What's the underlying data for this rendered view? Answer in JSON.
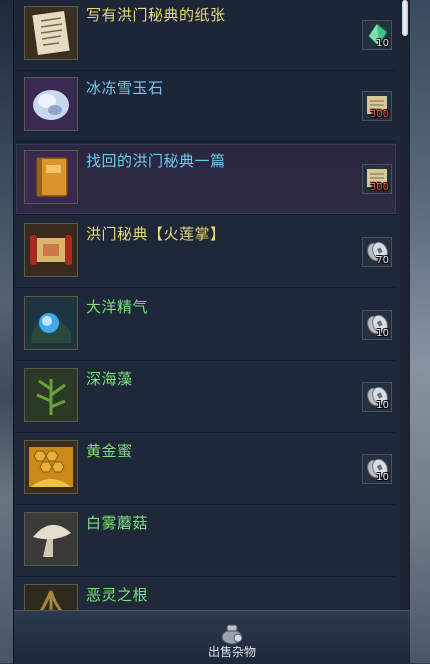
{
  "colors": {
    "name_gold": "#e9d77a",
    "name_blue": "#6fc8ee",
    "name_green": "#7be07b",
    "price_red": "#ff4a3a"
  },
  "items": [
    {
      "name": "写有洪门秘典的纸张",
      "name_color": "#e9d77a",
      "icon": "paper-scroll-icon",
      "currency": "jade-icon",
      "price": "10"
    },
    {
      "name": "冰冻雪玉石",
      "name_color": "#6fc8ee",
      "icon": "ice-jade-icon",
      "currency": "scroll-currency-icon",
      "price": "300"
    },
    {
      "name": "找回的洪门秘典一篇",
      "name_color": "#6fc8ee",
      "icon": "book-icon",
      "currency": "scroll-currency-icon",
      "price": "300"
    },
    {
      "name": "洪门秘典【火莲掌】",
      "name_color": "#e9d77a",
      "icon": "scroll-red-icon",
      "currency": "coin-icon",
      "price": "70"
    },
    {
      "name": "大洋精气",
      "name_color": "#7be07b",
      "icon": "ocean-essence-icon",
      "currency": "coin-icon",
      "price": "10"
    },
    {
      "name": "深海藻",
      "name_color": "#7be07b",
      "icon": "seaweed-icon",
      "currency": "coin-icon",
      "price": "10"
    },
    {
      "name": "黄金蜜",
      "name_color": "#7be07b",
      "icon": "honey-icon",
      "currency": "coin-icon",
      "price": "10"
    },
    {
      "name": "白雾蘑菇",
      "name_color": "#7be07b",
      "icon": "mushroom-icon",
      "currency": "",
      "price": ""
    },
    {
      "name": "恶灵之根",
      "name_color": "#7be07b",
      "icon": "root-icon",
      "currency": "",
      "price": ""
    }
  ],
  "bottom": {
    "sell_label": "出售杂物",
    "sell_icon": "money-bag-icon"
  }
}
